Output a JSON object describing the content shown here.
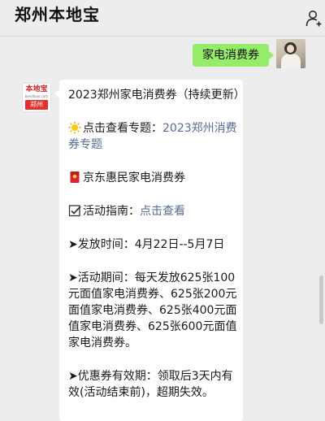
{
  "header": {
    "title": "郑州本地宝",
    "dots": "·  ·",
    "profile_icon": "person-icon"
  },
  "sent": {
    "text": "家电消费券",
    "avatar_icon": "user-avatar-photo"
  },
  "received": {
    "logo": {
      "name": "本地宝",
      "url": "bendibao.com",
      "city": "郑州"
    },
    "title": "2023郑州家电消费券（持续更新）",
    "topic_prefix": "点击查看专题：",
    "topic_link": "2023郑州消费券专题",
    "jd_text": "京东惠民家电消费券",
    "guide_prefix": "活动指南：",
    "guide_link": "点击查看",
    "release_time": "➤发放时间：4月22日--5月7日",
    "activity_period": "➤活动期间：每天发放625张100元面值家电消费券、625张200元面值家电消费券、625张400元面值家电消费券、625张600元面值家电消费券。",
    "validity": "➤优惠券有效期：领取后3天内有效(活动结束前)，超期失效。"
  },
  "colors": {
    "background": "#ededed",
    "sent_bubble": "#95ec69",
    "link": "#576b95",
    "logo_red": "#e3322e"
  }
}
